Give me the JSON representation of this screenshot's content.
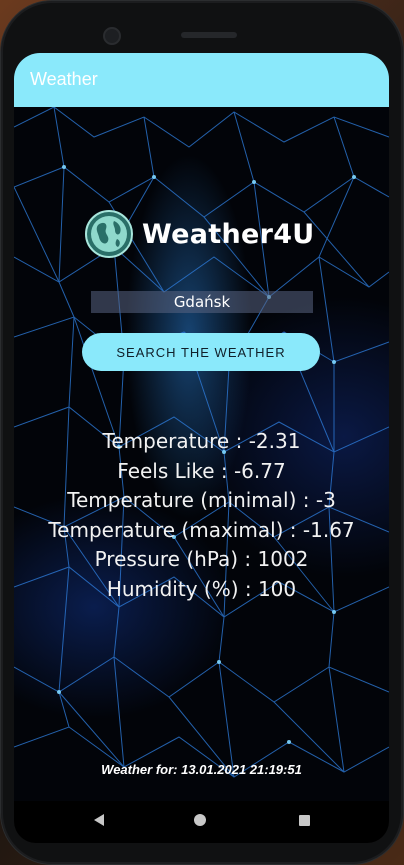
{
  "app": {
    "title": "Weather"
  },
  "logo": {
    "text": "Weather4U",
    "icon": "globe-icon"
  },
  "search": {
    "city_value": "Gdańsk",
    "button_label": "SEARCH THE WEATHER"
  },
  "weather": {
    "rows": [
      {
        "label": "Temperature",
        "value": "-2.31"
      },
      {
        "label": "Feels Like",
        "value": "-6.77"
      },
      {
        "label": "Temperature (minimal)",
        "value": "-3"
      },
      {
        "label": "Temperature (maximal)",
        "value": "-1.67"
      },
      {
        "label": "Pressure (hPa)",
        "value": "1002"
      },
      {
        "label": "Humidity (%)",
        "value": "100"
      }
    ]
  },
  "footer": {
    "timestamp": "Weather for: 13.01.2021 21:19:51"
  },
  "nav": {
    "back_icon": "back-triangle-icon",
    "home_icon": "home-circle-icon",
    "recents_icon": "recents-square-icon"
  },
  "colors": {
    "accent": "#8ae9fb",
    "background": "#020409"
  }
}
